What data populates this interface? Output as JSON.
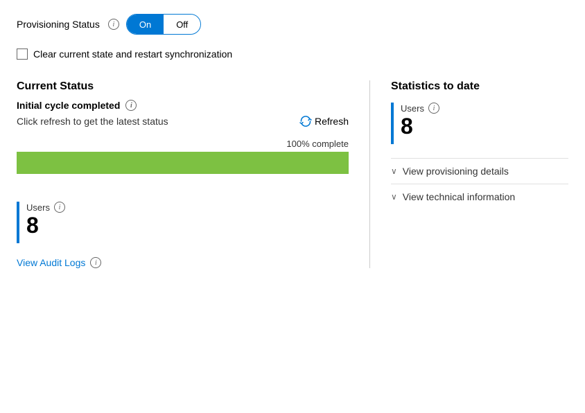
{
  "provisioning": {
    "label": "Provisioning Status",
    "info_icon": "i",
    "toggle_on": "On",
    "toggle_off": "Off"
  },
  "checkbox": {
    "label": "Clear current state and restart synchronization"
  },
  "current_status": {
    "title": "Current Status",
    "initial_cycle": "Initial cycle completed",
    "info_icon": "i",
    "refresh_text": "Click refresh to get the latest status",
    "refresh_label": "Refresh",
    "progress_label": "100% complete",
    "progress_value": 100
  },
  "bottom_left": {
    "users_label": "Users",
    "info_icon": "i",
    "users_count": "8",
    "audit_link": "View Audit Logs",
    "audit_info_icon": "i"
  },
  "statistics": {
    "title": "Statistics to date",
    "users_label": "Users",
    "info_icon": "i",
    "users_count": "8",
    "expandable": [
      {
        "label": "View provisioning details",
        "chevron": "∨"
      },
      {
        "label": "View technical information",
        "chevron": "∨"
      }
    ]
  }
}
